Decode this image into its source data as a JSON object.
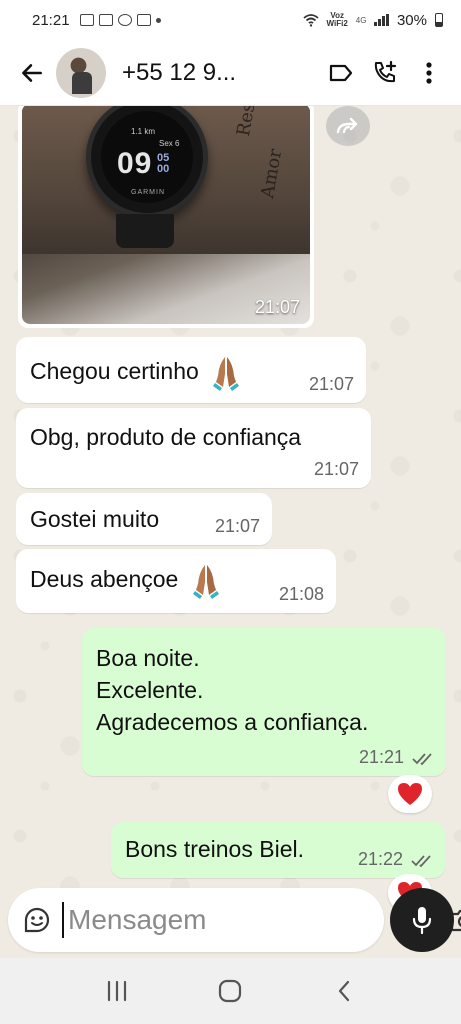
{
  "status_bar": {
    "time": "21:21",
    "carrier_line1": "Voz",
    "carrier_line2": "WiFi2",
    "network": "4G",
    "battery": "30%"
  },
  "header": {
    "contact_name": "+55 12 9...",
    "icons": [
      "back-arrow-icon",
      "label-icon",
      "add-call-icon",
      "more-vert-icon"
    ]
  },
  "watch": {
    "distance": "1.1 km",
    "day": "Sex 6",
    "hour": "09",
    "minutes": "05",
    "seconds": "00",
    "brand": "GARMIN"
  },
  "tattoo": {
    "line1": "Respeito",
    "line2": "Amor"
  },
  "messages": [
    {
      "type": "image",
      "direction": "in",
      "time": "21:07"
    },
    {
      "direction": "in",
      "text": "Chegou certinho",
      "emoji": "folded-hands",
      "time": "21:07"
    },
    {
      "direction": "in",
      "text": "Obg, produto de confiança",
      "time": "21:07"
    },
    {
      "direction": "in",
      "text": "Gostei muito",
      "time": "21:07"
    },
    {
      "direction": "in",
      "text": "Deus abençoe",
      "emoji": "folded-hands",
      "time": "21:08"
    },
    {
      "direction": "out",
      "lines": [
        "Boa noite.",
        "Excelente.",
        "Agradecemos a confiança."
      ],
      "time": "21:21",
      "status": "read",
      "reaction": "heart"
    },
    {
      "direction": "out",
      "text": "Bons treinos Biel.",
      "time": "21:22",
      "status": "read",
      "reaction": "heart"
    }
  ],
  "composer": {
    "placeholder": "Mensagem"
  },
  "nav": [
    "recents-icon",
    "home-icon",
    "back-icon"
  ]
}
